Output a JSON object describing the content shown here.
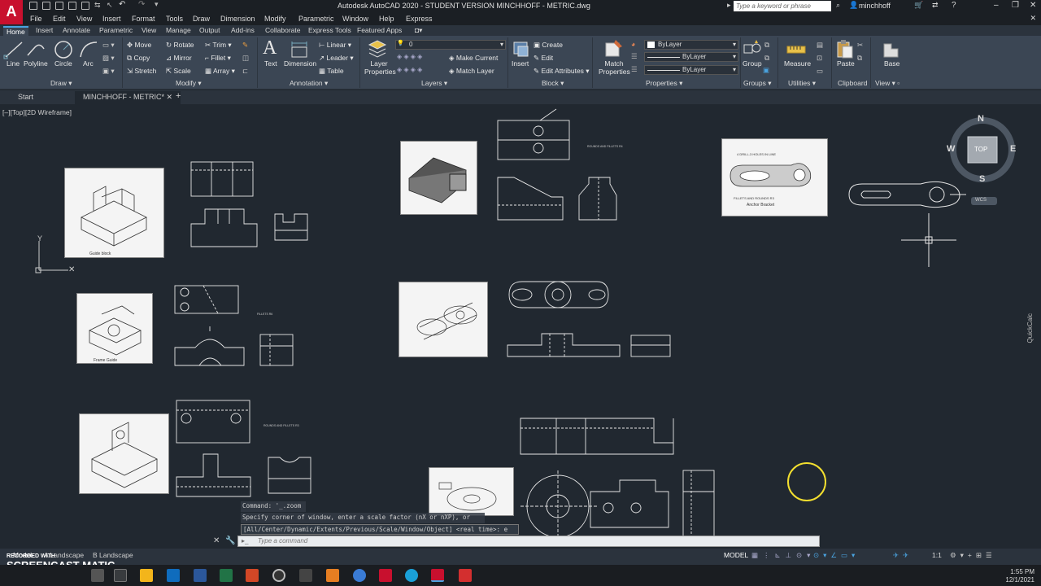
{
  "app": {
    "title": "Autodesk AutoCAD 2020 - STUDENT VERSION    MINCHHOFF - METRIC.dwg",
    "logo_letter": "A",
    "search_placeholder": "Type a keyword or phrase",
    "user": "minchhoff"
  },
  "menu": [
    "File",
    "Edit",
    "View",
    "Insert",
    "Format",
    "Tools",
    "Draw",
    "Dimension",
    "Modify",
    "Parametric",
    "Window",
    "Help",
    "Express"
  ],
  "ribbon_tabs": [
    "Home",
    "Insert",
    "Annotate",
    "Parametric",
    "View",
    "Manage",
    "Output",
    "Add-ins",
    "Collaborate",
    "Express Tools",
    "Featured Apps"
  ],
  "ribbon": {
    "draw": {
      "line": "Line",
      "polyline": "Polyline",
      "circle": "Circle",
      "arc": "Arc",
      "title": "Draw"
    },
    "modify": {
      "move": "Move",
      "rotate": "Rotate",
      "trim": "Trim",
      "copy": "Copy",
      "mirror": "Mirror",
      "fillet": "Fillet",
      "stretch": "Stretch",
      "scale": "Scale",
      "array": "Array",
      "title": "Modify"
    },
    "annotation": {
      "text": "Text",
      "dimension": "Dimension",
      "linear": "Linear",
      "leader": "Leader",
      "table": "Table",
      "title": "Annotation"
    },
    "layers": {
      "layer_properties": "Layer Properties",
      "layer_value": "0",
      "make_current": "Make Current",
      "match_layer": "Match Layer",
      "title": "Layers"
    },
    "block": {
      "insert": "Insert",
      "create": "Create",
      "edit": "Edit",
      "edit_attributes": "Edit Attributes",
      "title": "Block"
    },
    "properties": {
      "match": "Match Properties",
      "color": "ByLayer",
      "linetype": "ByLayer",
      "lineweight": "ByLayer",
      "title": "Properties"
    },
    "groups": {
      "group": "Group",
      "title": "Groups"
    },
    "utilities": {
      "measure": "Measure",
      "title": "Utilities"
    },
    "clipboard": {
      "paste": "Paste",
      "title": "Clipboard"
    },
    "view": {
      "base": "Base",
      "title": "View"
    }
  },
  "file_tabs": {
    "start": "Start",
    "drawing": "MINCHHOFF - METRIC*",
    "plus": "+"
  },
  "viewport_label": "[–][Top][2D Wireframe]",
  "viewcube": {
    "n": "N",
    "s": "S",
    "e": "E",
    "w": "W",
    "top": "TOP",
    "wcs": "WCS"
  },
  "drawing_labels": {
    "guide_block": "Guide block",
    "frame_guide": "Frame Guide",
    "anchor_bracket": "Anchor Bracket",
    "rounds_fillets": "ROUNDS AND FILLETS R3",
    "four_holes": "4 DRILL-3 HOLES IN LINE",
    "fillets_rounds": "FILLETS AND ROUNDS R3",
    "rounds_fillets_r4": "ROUNDS AND FILLETS R4",
    "fillets_r6": "FILLETS R6"
  },
  "command": {
    "line1": "Command: '_.zoom",
    "line2": "Specify corner of window, enter a scale factor (nX or nXP), or",
    "line3": "[All/Center/Dynamic/Extents/Previous/Scale/Window/Object] <real time>:  e",
    "input_placeholder": "Type a command"
  },
  "status": {
    "model": "Model",
    "layout1": "A Landscape",
    "layout2": "B Landscape",
    "model_btn": "MODEL",
    "scale": "1:1"
  },
  "quickcalc": "QuickCalc",
  "taskbar": {
    "time": "1:55 PM",
    "date": "12/1/2021",
    "recorded": "RECORDED WITH",
    "screencast": "SCREENCAST",
    "matic": "MATIC"
  },
  "colors": {
    "accent": "#4aa3df",
    "canvas": "#212830",
    "ribbon": "#3b4654",
    "logo": "#c8102e",
    "cursor": "#f3df2f"
  }
}
